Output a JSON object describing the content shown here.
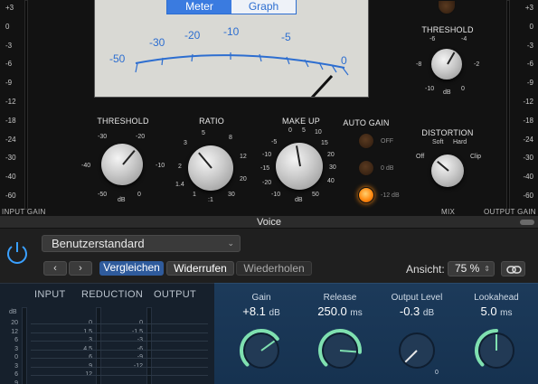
{
  "compressor": {
    "meter_toggle": {
      "meter": "Meter",
      "graph": "Graph"
    },
    "meter_scale": [
      "-50",
      "-30",
      "-20",
      "-10",
      "-5",
      "0"
    ],
    "left_scale": [
      "+3",
      "0",
      "-3",
      "-6",
      "-9",
      "-12",
      "-18",
      "-24",
      "-30",
      "-40",
      "-60"
    ],
    "right_scale": [
      "+3",
      "0",
      "-3",
      "-6",
      "-9",
      "-12",
      "-18",
      "-24",
      "-30",
      "-40",
      "-60"
    ],
    "input_gain_caption": "INPUT GAIN",
    "mix_caption": "MIX",
    "output_gain_caption": "OUTPUT GAIN",
    "threshold": {
      "label": "THRESHOLD",
      "scale": [
        "-30",
        "-20",
        "-40",
        "-10",
        "-50",
        "0"
      ],
      "unit": "dB"
    },
    "ratio": {
      "label": "RATIO",
      "scale": [
        "5",
        "8",
        "3",
        "12",
        "2",
        "20",
        "1.4",
        "30",
        "1",
        ":1"
      ]
    },
    "makeup": {
      "label": "MAKE UP",
      "scale": [
        "0",
        "5",
        "10",
        "15",
        "-5",
        "20",
        "-10",
        "30",
        "-15",
        "40",
        "-20",
        "50"
      ],
      "unit": "dB"
    },
    "auto_gain": {
      "label": "AUTO GAIN",
      "options": [
        "OFF",
        "0 dB",
        "-12 dB"
      ],
      "active_index": 2
    },
    "threshold2": {
      "label": "THRESHOLD",
      "scale": [
        "-6",
        "-4",
        "-8",
        "-2",
        "-10",
        "0"
      ],
      "unit": "dB"
    },
    "distortion": {
      "label": "DISTORTION",
      "options": [
        "Soft",
        "Hard",
        "Off",
        "Clip"
      ]
    }
  },
  "plugin": {
    "title": "Voice",
    "preset": "Benutzerstandard",
    "compare_label": "Vergleichen",
    "undo_label": "Widerrufen",
    "redo_label": "Wiederholen",
    "view_label": "Ansicht:",
    "zoom": "75 %",
    "nav_back": "‹",
    "nav_forward": "›",
    "meters": {
      "input_label": "INPUT",
      "reduction_label": "REDUCTION",
      "output_label": "OUTPUT",
      "db_label": "dB",
      "input_scale": [
        "20",
        "12",
        "6",
        "3",
        "0",
        "3",
        "6",
        "9"
      ],
      "reduction_scale": [
        "0",
        "1.5",
        "3",
        "4.5",
        "6",
        "9",
        "12"
      ],
      "output_scale": [
        "0",
        "-1.5",
        "-3",
        "-6",
        "-9",
        "-12"
      ]
    },
    "controls": [
      {
        "name": "Gain",
        "value": "+8.1",
        "unit": "dB",
        "fraction": 0.7
      },
      {
        "name": "Release",
        "value": "250.0",
        "unit": "ms",
        "fraction": 0.85
      },
      {
        "name": "Output Level",
        "value": "-0.3",
        "unit": "dB",
        "fraction": 0.0
      },
      {
        "name": "Lookahead",
        "value": "5.0",
        "unit": "ms",
        "fraction": 0.5
      }
    ],
    "output_level_min": "0",
    "accent_color": "#7fe0b0"
  }
}
